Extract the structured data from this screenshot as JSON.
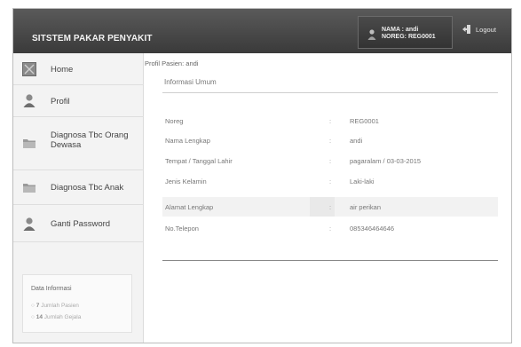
{
  "app": {
    "title": "SITSTEM PAKAR PENYAKIT"
  },
  "user": {
    "name_line": "NAMA : andi",
    "noreg_line": "NOREG: REG0001"
  },
  "logout": {
    "label": "Logout"
  },
  "sidebar": {
    "items": [
      {
        "label": "Home",
        "icon": "home-icon"
      },
      {
        "label": "Profil",
        "icon": "user-icon"
      },
      {
        "label": "Diagnosa Tbc Orang Dewasa",
        "icon": "folder-icon"
      },
      {
        "label": "Diagnosa Tbc Anak",
        "icon": "folder-icon"
      },
      {
        "label": "Ganti Password",
        "icon": "user-icon"
      }
    ],
    "info": {
      "title": "Data Informasi",
      "lines": [
        {
          "count": "7",
          "text": "Jumlah Pasien"
        },
        {
          "count": "14",
          "text": "Jumlah Gejala"
        }
      ]
    }
  },
  "main": {
    "breadcrumb": "Profil Pasien: andi",
    "section_title": "Informasi Umum",
    "separator": ":",
    "rows": [
      {
        "key": "Noreg",
        "value": "REG0001"
      },
      {
        "key": "Nama Lengkap",
        "value": "andi"
      },
      {
        "key": "Tempat / Tanggal Lahir",
        "value": "pagaralam / 03-03-2015"
      },
      {
        "key": "Jenis Kelamin",
        "value": "Laki-laki"
      },
      {
        "key": "Alamat Lengkap",
        "value": "air perikan"
      },
      {
        "key": "No.Telepon",
        "value": "085346464646"
      }
    ]
  }
}
